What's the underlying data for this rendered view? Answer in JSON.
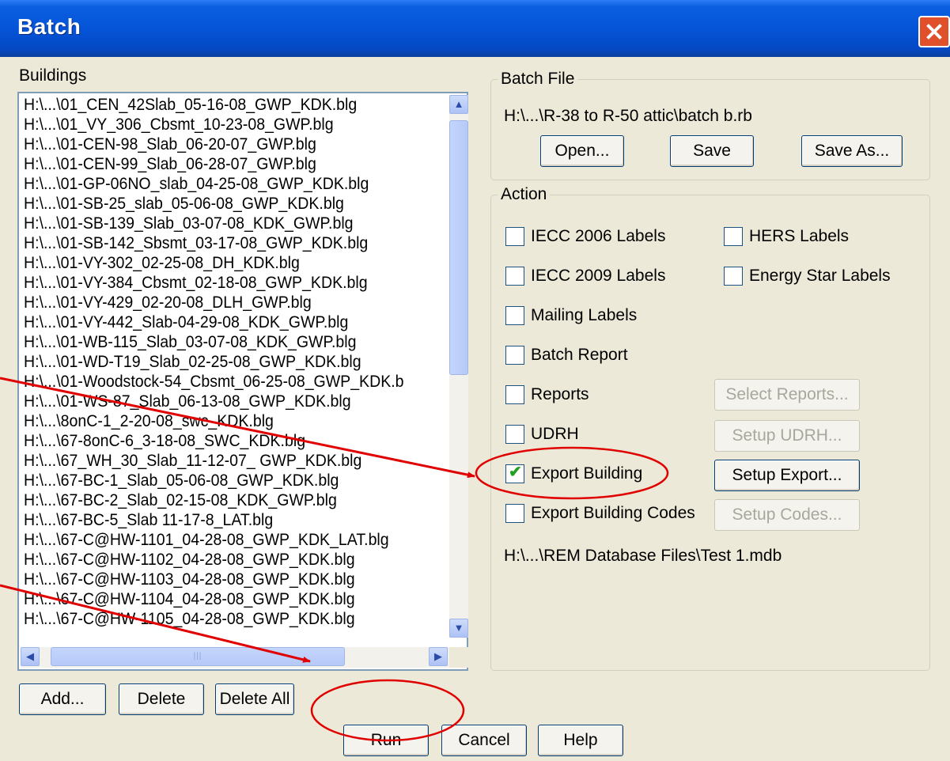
{
  "window": {
    "title": "Batch"
  },
  "buildings": {
    "label": "Buildings",
    "files": [
      "H:\\...\\01_CEN_42Slab_05-16-08_GWP_KDK.blg",
      "H:\\...\\01_VY_306_Cbsmt_10-23-08_GWP.blg",
      "H:\\...\\01-CEN-98_Slab_06-20-07_GWP.blg",
      "H:\\...\\01-CEN-99_Slab_06-28-07_GWP.blg",
      "H:\\...\\01-GP-06NO_slab_04-25-08_GWP_KDK.blg",
      "H:\\...\\01-SB-25_slab_05-06-08_GWP_KDK.blg",
      "H:\\...\\01-SB-139_Slab_03-07-08_KDK_GWP.blg",
      "H:\\...\\01-SB-142_Sbsmt_03-17-08_GWP_KDK.blg",
      "H:\\...\\01-VY-302_02-25-08_DH_KDK.blg",
      "H:\\...\\01-VY-384_Cbsmt_02-18-08_GWP_KDK.blg",
      "H:\\...\\01-VY-429_02-20-08_DLH_GWP.blg",
      "H:\\...\\01-VY-442_Slab-04-29-08_KDK_GWP.blg",
      "H:\\...\\01-WB-115_Slab_03-07-08_KDK_GWP.blg",
      "H:\\...\\01-WD-T19_Slab_02-25-08_GWP_KDK.blg",
      "H:\\...\\01-Woodstock-54_Cbsmt_06-25-08_GWP_KDK.b",
      "H:\\...\\01-WS-87_Slab_06-13-08_GWP_KDK.blg",
      "H:\\...\\8onC-1_2-20-08_swc_KDK.blg",
      "H:\\...\\67-8onC-6_3-18-08_SWC_KDK.blg",
      "H:\\...\\67_WH_30_Slab_11-12-07_ GWP_KDK.blg",
      "H:\\...\\67-BC-1_Slab_05-06-08_GWP_KDK.blg",
      "H:\\...\\67-BC-2_Slab_02-15-08_KDK_GWP.blg",
      "H:\\...\\67-BC-5_Slab 11-17-8_LAT.blg",
      "H:\\...\\67-C@HW-1101_04-28-08_GWP_KDK_LAT.blg",
      "H:\\...\\67-C@HW-1102_04-28-08_GWP_KDK.blg",
      "H:\\...\\67-C@HW-1103_04-28-08_GWP_KDK.blg",
      "H:\\...\\67-C@HW-1104_04-28-08_GWP_KDK.blg",
      "H:\\...\\67-C@HW-1105_04-28-08_GWP_KDK.blg"
    ],
    "add_label": "Add...",
    "delete_label": "Delete",
    "delete_all_label": "Delete All"
  },
  "batch_file": {
    "legend": "Batch File",
    "path": "H:\\...\\R-38 to R-50 attic\\batch b.rb",
    "open_label": "Open...",
    "save_label": "Save",
    "save_as_label": "Save As..."
  },
  "action": {
    "legend": "Action",
    "iecc2006": {
      "label": "IECC 2006 Labels",
      "checked": false
    },
    "hers": {
      "label": "HERS Labels",
      "checked": false
    },
    "iecc2009": {
      "label": "IECC 2009 Labels",
      "checked": false
    },
    "energy_star": {
      "label": "Energy Star Labels",
      "checked": false
    },
    "mailing": {
      "label": "Mailing Labels",
      "checked": false
    },
    "batch_report": {
      "label": "Batch Report",
      "checked": false
    },
    "reports": {
      "label": "Reports",
      "checked": false
    },
    "select_reports_label": "Select Reports...",
    "udrh": {
      "label": "UDRH",
      "checked": false
    },
    "setup_udrh_label": "Setup UDRH...",
    "export_building": {
      "label": "Export Building",
      "checked": true
    },
    "setup_export_label": "Setup Export...",
    "export_codes": {
      "label": "Export Building Codes",
      "checked": false
    },
    "setup_codes_label": "Setup Codes...",
    "database_path": "H:\\...\\REM Database Files\\Test 1.mdb"
  },
  "footer": {
    "run_label": "Run",
    "cancel_label": "Cancel",
    "help_label": "Help"
  },
  "colors": {
    "annotation": "#e00000",
    "title_bar": "#0554d8"
  }
}
